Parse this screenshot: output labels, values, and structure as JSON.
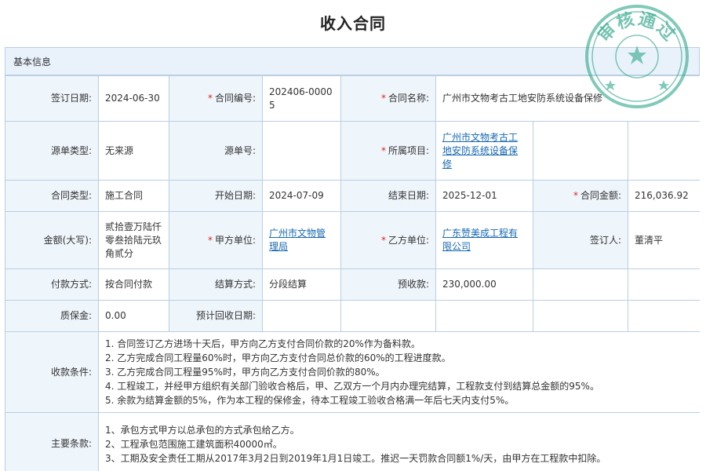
{
  "page": {
    "title": "收入合同"
  },
  "section": {
    "label": "基本信息"
  },
  "labels": {
    "sign_date": "签订日期:",
    "contract_no": "合同编号:",
    "contract_name": "合同名称:",
    "source_type": "源单类型:",
    "source_no": "源单号:",
    "project": "所属项目:",
    "contract_type": "合同类型:",
    "start_date": "开始日期:",
    "end_date": "结束日期:",
    "amount": "合同金额:",
    "amount_cn": "金额(大写):",
    "party_a": "甲方单位:",
    "party_b": "乙方单位:",
    "signer": "签订人:",
    "pay_method": "付款方式:",
    "settle_method": "结算方式:",
    "prepay": "预收款:",
    "deposit": "质保金:",
    "expected_date": "预计回收日期:",
    "terms": "收款条件:",
    "main_terms": "主要条款:"
  },
  "values": {
    "sign_date": "2024-06-30",
    "contract_no": "202406-00005",
    "contract_name": "广州市文物考古工地安防系统设备保修",
    "source_type": "无来源",
    "source_no": "",
    "project": "广州市文物考古工地安防系统设备保修",
    "contract_type": "施工合同",
    "start_date": "2024-07-09",
    "end_date": "2025-12-01",
    "amount": "216,036.92",
    "amount_cn": "贰拾壹万陆仟零叁拾陆元玖角贰分",
    "party_a": "广州市文物管理局",
    "party_b": "广东赞美成工程有限公司",
    "signer": "董清平",
    "pay_method": "按合同付款",
    "settle_method": "分段结算",
    "prepay": "230,000.00",
    "deposit": "0.00",
    "expected_date": ""
  },
  "terms": [
    "1. 合同签订乙方进场十天后，甲方向乙方支付合同价款的20%作为备料款。",
    "2. 乙方完成合同工程量60%时，甲方向乙方支付合同总价款的60%的工程进度款。",
    "3. 乙方完成合同工程量95%时，甲方向乙方支付合同价款的80%。",
    "4. 工程竣工，并经甲方组织有关部门验收合格后，甲、乙双方一个月内办理完结算，工程款支付到结算总金额的95%。",
    "5. 余款为结算金额的5%，作为本工程的保修金，待本工程竣工验收合格满一年后七天内支付5%。"
  ],
  "main_terms": [
    "1、承包方式甲方以总承包的方式承包给乙方。",
    "2、工程承包范围施工建筑面积40000㎡。",
    "3、工期及安全责任工期从2017年3月2日到2019年1月1日竣工。推迟一天罚款合同额1%/天，由甲方在工程款中扣除。"
  ],
  "stamp": {
    "text": "审核通过",
    "color": "#2fa68a"
  },
  "colors": {
    "label_bg": "#eef5fb",
    "border": "#b9cfe3",
    "link": "#1769b3",
    "required": "#e0281b"
  }
}
